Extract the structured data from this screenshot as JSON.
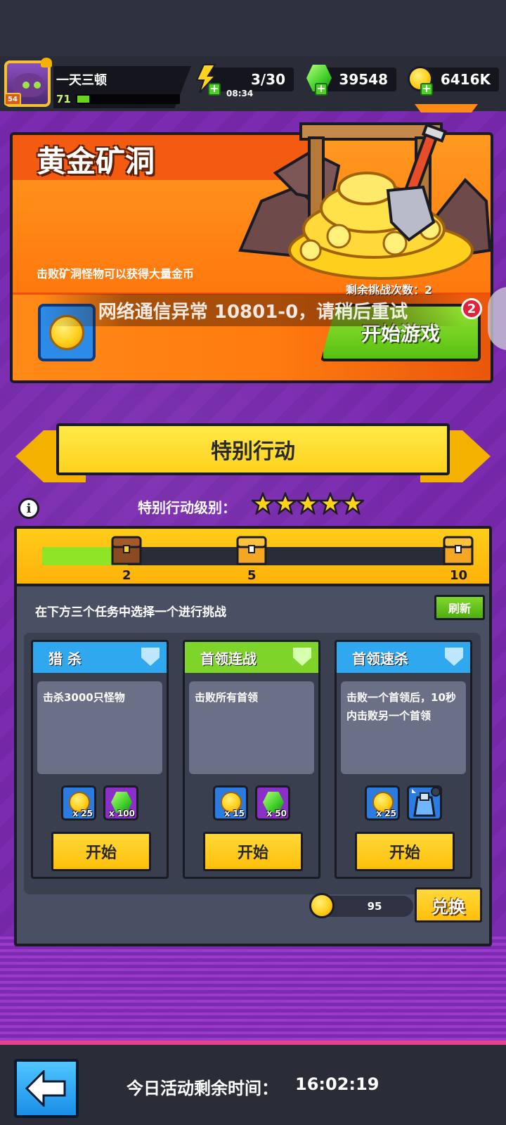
{
  "player": {
    "name": "一天三顿",
    "avatar_level": "54",
    "level": "71",
    "xp_fraction": 0.12
  },
  "resources": {
    "energy": "3/30",
    "energy_timer": "08:34",
    "gems": "39548",
    "gold": "6416K"
  },
  "mine": {
    "title": "黄金矿洞",
    "description": "击败矿洞怪物可以获得大量金币",
    "attempts": "剩余挑战次数：2",
    "start_button": "开始游戏",
    "notification_count": "2"
  },
  "toast": {
    "message": "网络通信异常 10801-0，请稍后重试"
  },
  "special": {
    "banner_title": "特别行动",
    "level_label": "特别行动级别：",
    "stars": 5,
    "progress_fraction": 0.2,
    "milestones": [
      "2",
      "5",
      "10"
    ],
    "task_prompt": "在下方三个任务中选择一个进行挑战",
    "refresh_label": "刷新",
    "tasks": [
      {
        "title": "猎 杀",
        "description": "击杀3000只怪物",
        "header_color": "#2fa8f0",
        "rewards": [
          {
            "icon": "gold-coin-icon",
            "qty": "x 25"
          },
          {
            "icon": "green-gem-icon",
            "qty": "x 100"
          }
        ],
        "start_label": "开始"
      },
      {
        "title": "首领连战",
        "description": "击败所有首领",
        "header_color": "#7fd42a",
        "rewards": [
          {
            "icon": "gold-coin-icon",
            "qty": "x 15"
          },
          {
            "icon": "green-gem-icon",
            "qty": "x 50"
          }
        ],
        "start_label": "开始"
      },
      {
        "title": "首领速杀",
        "description": "击败一个首领后，10秒内击败另一个首领",
        "header_color": "#2fa8f0",
        "rewards": [
          {
            "icon": "gold-coin-icon",
            "qty": "x 25"
          },
          {
            "icon": "armor-upgrade-icon",
            "qty": ""
          }
        ],
        "start_label": "开始"
      }
    ],
    "exchange_amount": "95",
    "exchange_label": "兑换"
  },
  "footer": {
    "time_label": "今日活动剩余时间：",
    "time_value": "16:02:19"
  },
  "colors": {
    "accent_yellow": "#ffd21c",
    "mine_orange": "#ff7a0f",
    "start_green": "#58c012",
    "panel_bg": "#4a5064",
    "purple_bg": "#7b2bb0"
  }
}
